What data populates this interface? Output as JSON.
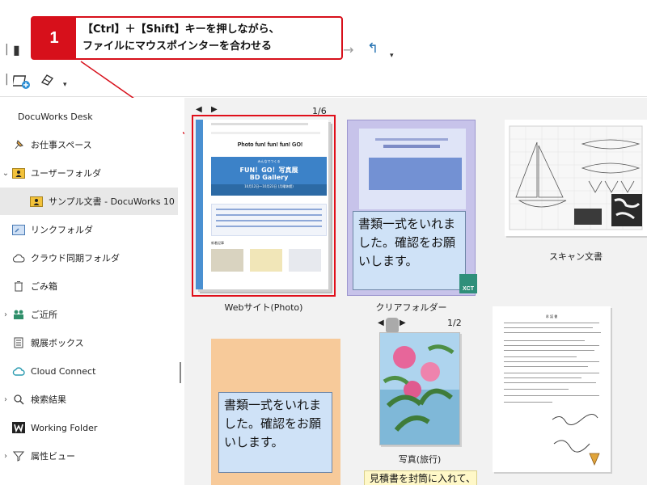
{
  "callout": {
    "number": "1",
    "line1": "【Ctrl】＋【Shift】キーを押しながら、",
    "line2": "ファイルにマウスポインターを合わせる"
  },
  "toolbar": {
    "icons": [
      "book-icon",
      "arrow-right-icon",
      "up-arrow-icon",
      "new-binder-icon",
      "eraser-icon"
    ]
  },
  "sidebar": {
    "items": [
      {
        "label": "DocuWorks Desk",
        "icon": ""
      },
      {
        "label": "お仕事スペース",
        "icon": "pin-icon"
      },
      {
        "label": "ユーザーフォルダ",
        "icon": "folder-user-icon"
      },
      {
        "label": "サンプル文書 - DocuWorks 10",
        "icon": "folder-user-icon"
      },
      {
        "label": "リンクフォルダ",
        "icon": "link-folder-icon"
      },
      {
        "label": "クラウド同期フォルダ",
        "icon": "cloud-icon"
      },
      {
        "label": "ごみ箱",
        "icon": "trash-icon"
      },
      {
        "label": "ご近所",
        "icon": "people-icon"
      },
      {
        "label": "親展ボックス",
        "icon": "inbox-icon"
      },
      {
        "label": "Cloud Connect",
        "icon": "cloud-connect-icon"
      },
      {
        "label": "検索結果",
        "icon": "search-icon"
      },
      {
        "label": "Working Folder",
        "icon": "working-folder-icon"
      },
      {
        "label": "属性ビュー",
        "icon": "filter-icon"
      }
    ]
  },
  "content": {
    "doc1": {
      "page_count": "1/6",
      "label": "Webサイト(Photo)",
      "site_title": "Photo fun! fun! fun! GO!",
      "banner_small": "みんなでつくる",
      "banner_main": "FUN！GO！写真展",
      "banner_sub": "BD Gallery",
      "banner_date": "10月12日～10月23日 (月曜休館)",
      "section_label": "新着記事"
    },
    "doc2": {
      "label": "クリアフォルダー",
      "note": "書類一式をいれました。確認をお願いします。",
      "badge": "XCT"
    },
    "doc3": {
      "label": "スキャン文書"
    },
    "doc4": {
      "note": "書類一式をいれました。確認をお願いします。"
    },
    "doc5": {
      "page_count": "1/2",
      "label": "写真(旅行)",
      "sticky": "見積書を封筒に入れて、"
    },
    "doc6": {
      "title": "承 諾 書"
    }
  },
  "colors": {
    "accent_red": "#d7101b",
    "selected_bg": "#e8e8e8",
    "content_bg": "#f2f2f2"
  }
}
